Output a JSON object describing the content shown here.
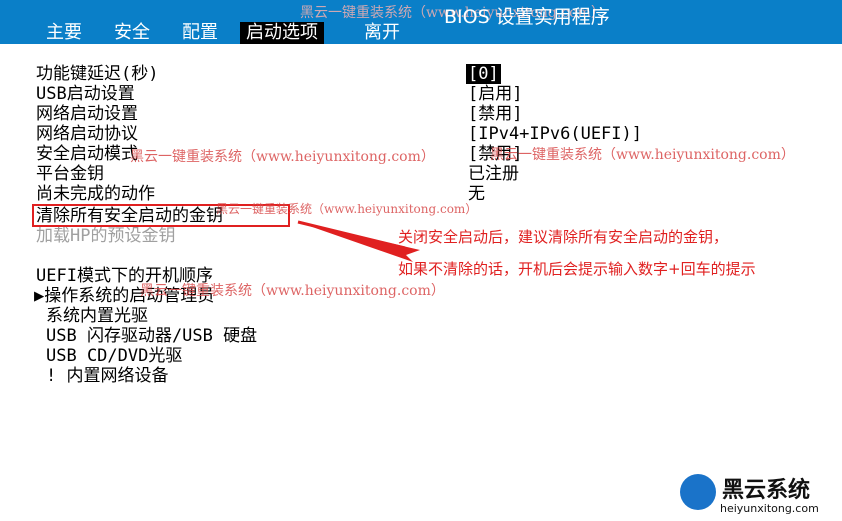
{
  "header": {
    "watermark_top": "黑云一键重装系统（www.heiyunxitong.com）",
    "title": "BIOS 设置实用程序",
    "menu": [
      {
        "label": "主要"
      },
      {
        "label": "安全"
      },
      {
        "label": "配置"
      },
      {
        "label": "启动选项"
      },
      {
        "label": "离开"
      }
    ]
  },
  "settings": [
    {
      "label": "功能键延迟(秒)",
      "value": "[0]"
    },
    {
      "label": "USB启动设置",
      "value": "[启用]"
    },
    {
      "label": "网络启动设置",
      "value": "[禁用]"
    },
    {
      "label": "网络启动协议",
      "value": "[IPv4+IPv6(UEFI)]"
    },
    {
      "label": "安全启动模式",
      "value": "[禁用]"
    },
    {
      "label": "平台金钥",
      "value": "已注册"
    },
    {
      "label": "尚未完成的动作",
      "value": "无"
    },
    {
      "label": "清除所有安全启动的金钥",
      "value": ""
    },
    {
      "label": "加载HP的预设金钥",
      "value": ""
    }
  ],
  "boot_order": {
    "heading": "UEFI模式下的开机顺序",
    "items": [
      {
        "label": "▶操作系统的启动管理员"
      },
      {
        "label": "系统内置光驱"
      },
      {
        "label": "USB 闪存驱动器/USB 硬盘"
      },
      {
        "label": "USB CD/DVD光驱"
      },
      {
        "label": "! 内置网络设备"
      }
    ]
  },
  "watermarks": {
    "wm1": "黑云一键重装系统（www.heiyunxitong.com）",
    "wm2": "黑云一键重装系统（www.heiyunxitong.com）",
    "wm3": "黑云一键重装系统（www.heiyunxitong.com）",
    "wm4": "黑云一键重装系统（www.heiyunxitong.com）"
  },
  "annotation": {
    "line1": "关闭安全启动后，建议清除所有安全启动的金钥，",
    "line2": "如果不清除的话，开机后会提示输入数字+回车的提示"
  },
  "logo": {
    "name": "黑云系统",
    "url": "heiyunxitong.com"
  },
  "colors": {
    "header_bg": "#0a7fc8",
    "annotation": "#e02020",
    "disabled_text": "#a0a0a0"
  }
}
